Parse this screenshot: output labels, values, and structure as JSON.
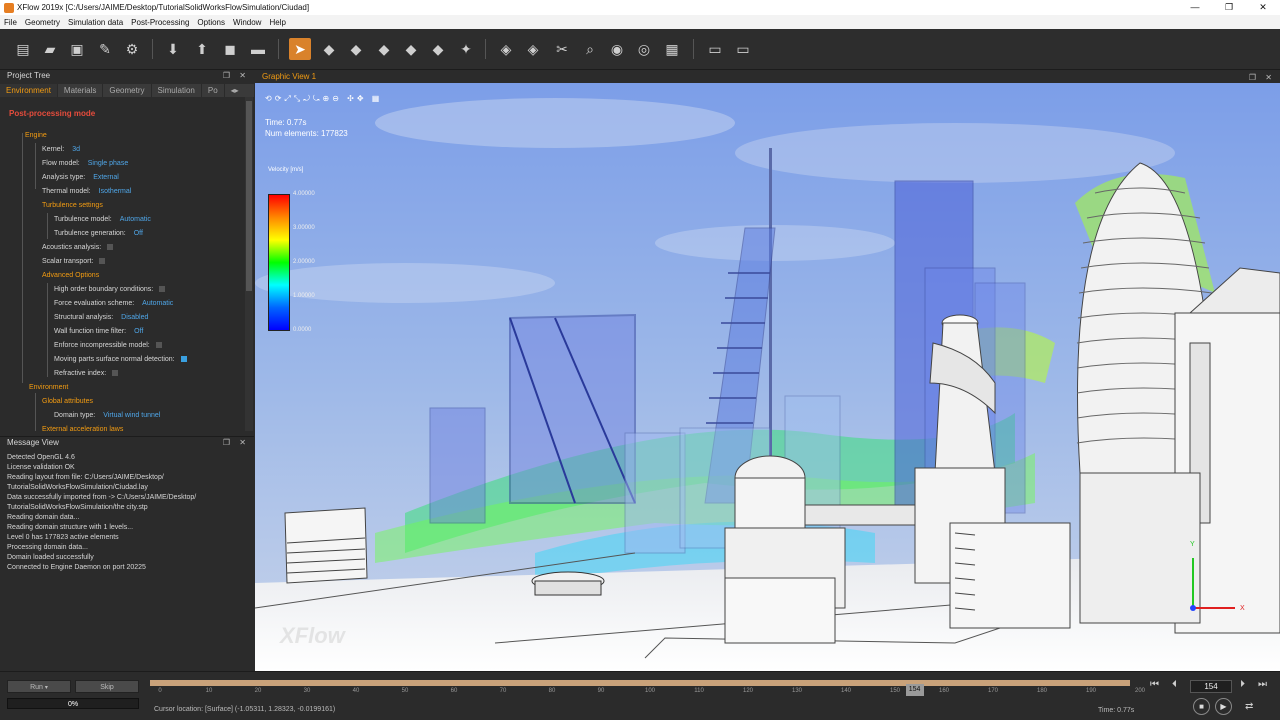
{
  "window": {
    "title": "XFlow 2019x [C:/Users/JAIME/Desktop/TutorialSolidWorksFlowSimulation/Ciudad]",
    "minimize": "—",
    "maximize": "❐",
    "close": "✕"
  },
  "menu": [
    "File",
    "Geometry",
    "Simulation data",
    "Post-Processing",
    "Options",
    "Window",
    "Help"
  ],
  "project_tree": {
    "header": "Project Tree",
    "tabs": [
      "Environment",
      "Materials",
      "Geometry",
      "Simulation",
      "Po"
    ],
    "mode": "Post-processing mode",
    "rows": [
      {
        "label": "Engine",
        "type": "group"
      },
      {
        "label": "Kernel:",
        "value": "3d"
      },
      {
        "label": "Flow model:",
        "value": "Single phase"
      },
      {
        "label": "Analysis type:",
        "value": "External"
      },
      {
        "label": "Thermal model:",
        "value": "Isothermal"
      },
      {
        "label": "Turbulence settings",
        "type": "group"
      },
      {
        "label": "Turbulence model:",
        "value": "Automatic"
      },
      {
        "label": "Turbulence generation:",
        "value": "Off"
      },
      {
        "label": "Acoustics analysis:",
        "check": false
      },
      {
        "label": "Scalar transport:",
        "check": false
      },
      {
        "label": "Advanced Options",
        "type": "group"
      },
      {
        "label": "High order boundary conditions:",
        "check": false
      },
      {
        "label": "Force evaluation scheme:",
        "value": "Automatic"
      },
      {
        "label": "Structural analysis:",
        "value": "Disabled"
      },
      {
        "label": "Wall function time filter:",
        "value": "Off"
      },
      {
        "label": "Enforce incompressible model:",
        "check": false
      },
      {
        "label": "Moving parts surface normal detection:",
        "check": true
      },
      {
        "label": "Refractive index:",
        "check": false
      },
      {
        "label": "Environment",
        "type": "group"
      },
      {
        "label": "Global attributes",
        "type": "group"
      },
      {
        "label": "Domain type:",
        "value": "Virtual wind tunnel"
      },
      {
        "label": "External acceleration laws",
        "type": "group"
      }
    ]
  },
  "message_view": {
    "header": "Message View",
    "lines": [
      "Detected OpenGL 4.6",
      "License validation OK",
      "Reading layout from file: C:/Users/JAIME/Desktop/",
      "TutorialSolidWorksFlowSimulation/Ciudad.lay",
      "Data successfully imported from -> C:/Users/JAIME/Desktop/",
      "TutorialSolidWorksFlowSimulation/the city.stp",
      "Reading domain data...",
      "Reading domain structure with 1 levels...",
      "   Level 0 has 177823 active elements",
      "Processing domain data...",
      "Domain loaded successfully",
      "Connected to Engine Daemon on port 20225"
    ]
  },
  "graphic_view": {
    "tab": "Graphic View 1",
    "time": "Time: 0.77s",
    "num_elements": "Num elements: 177823",
    "legend_title": "Velocity [m/s]",
    "legend_ticks": [
      "4.00000",
      "3.00000",
      "2.00000",
      "1.00000",
      "0.0000"
    ],
    "watermark": "XFlow",
    "axis_y": "Y",
    "axis_x": "X"
  },
  "bottom": {
    "run": "Run",
    "skip": "Skip",
    "progress": "0%",
    "progress_value": 0,
    "ticks": [
      "0",
      "10",
      "20",
      "30",
      "40",
      "50",
      "60",
      "70",
      "80",
      "90",
      "100",
      "110",
      "120",
      "130",
      "140",
      "150",
      "160",
      "170",
      "180",
      "190",
      "200"
    ],
    "current_frame": "154",
    "current_frame_value": 154,
    "frame_max": 200,
    "cursor_location": "Cursor location:   [Surface] (-1.05311, 1.28323, -0.0199161)",
    "time": "Time: 0.77s"
  },
  "colors": {
    "accent": "#f39c12",
    "value": "#4fa6e8",
    "mode": "#e74c3c",
    "active_tool": "#d9822b"
  }
}
